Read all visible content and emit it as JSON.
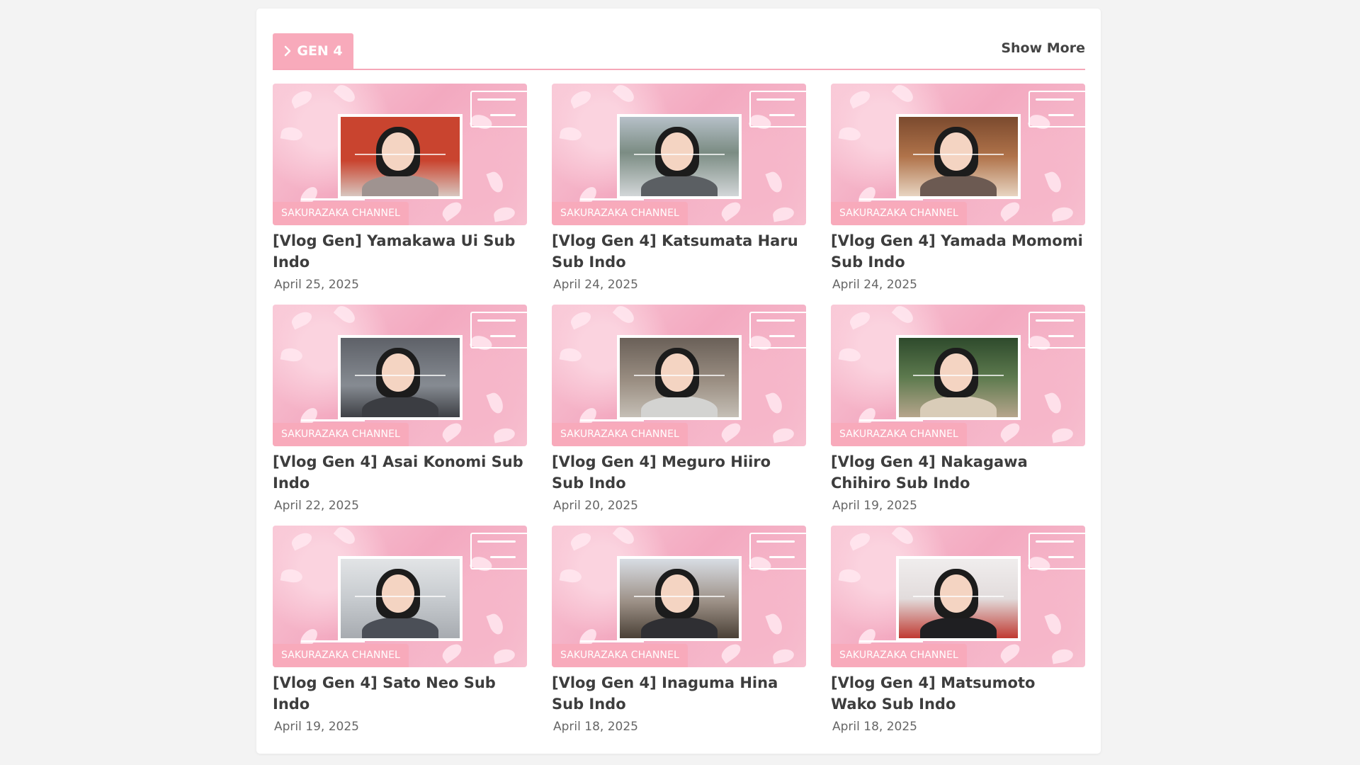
{
  "section": {
    "tab_label": "GEN 4",
    "tab_icon": "chevron-right-icon",
    "show_more_label": "Show More",
    "accent_color": "#f8aabb"
  },
  "videos": [
    {
      "badge": "SAKURAZAKA CHANNEL",
      "title": "[Vlog Gen] Yamakawa Ui Sub Indo",
      "date": "April 25, 2025"
    },
    {
      "badge": "SAKURAZAKA CHANNEL",
      "title": "[Vlog Gen 4] Katsumata Haru Sub Indo",
      "date": "April 24, 2025"
    },
    {
      "badge": "SAKURAZAKA CHANNEL",
      "title": "[Vlog Gen 4] Yamada Momomi Sub Indo",
      "date": "April 24, 2025"
    },
    {
      "badge": "SAKURAZAKA CHANNEL",
      "title": "[Vlog Gen 4] Asai Konomi Sub Indo",
      "date": "April 22, 2025"
    },
    {
      "badge": "SAKURAZAKA CHANNEL",
      "title": "[Vlog Gen 4] Meguro Hiiro Sub Indo",
      "date": "April 20, 2025"
    },
    {
      "badge": "SAKURAZAKA CHANNEL",
      "title": "[Vlog Gen 4] Nakagawa Chihiro Sub Indo",
      "date": "April 19, 2025"
    },
    {
      "badge": "SAKURAZAKA CHANNEL",
      "title": "[Vlog Gen 4] Sato Neo Sub Indo",
      "date": "April 19, 2025"
    },
    {
      "badge": "SAKURAZAKA CHANNEL",
      "title": "[Vlog Gen 4] Inaguma Hina Sub Indo",
      "date": "April 18, 2025"
    },
    {
      "badge": "SAKURAZAKA CHANNEL",
      "title": "[Vlog Gen 4] Matsumoto Wako Sub Indo",
      "date": "April 18, 2025"
    }
  ]
}
